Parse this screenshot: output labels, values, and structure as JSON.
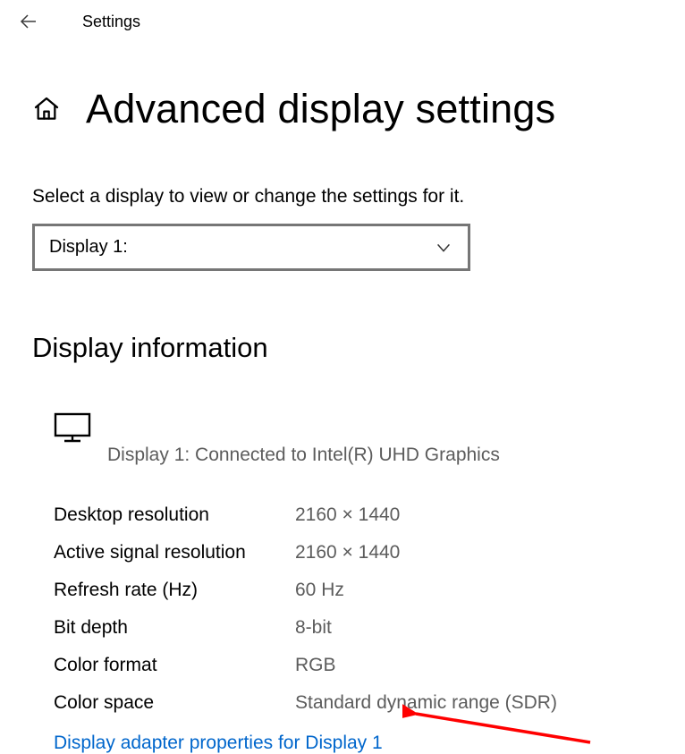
{
  "topbar": {
    "app_label": "Settings"
  },
  "header": {
    "title": "Advanced display settings"
  },
  "selector": {
    "instruction": "Select a display to view or change the settings for it.",
    "selected": "Display 1:"
  },
  "info_section": {
    "title": "Display information",
    "connected_text": "Display 1: Connected to Intel(R) UHD Graphics",
    "rows": [
      {
        "label": "Desktop resolution",
        "value": "2160 × 1440"
      },
      {
        "label": "Active signal resolution",
        "value": "2160 × 1440"
      },
      {
        "label": "Refresh rate (Hz)",
        "value": "60 Hz"
      },
      {
        "label": "Bit depth",
        "value": "8-bit"
      },
      {
        "label": "Color format",
        "value": "RGB"
      },
      {
        "label": "Color space",
        "value": "Standard dynamic range (SDR)"
      }
    ],
    "adapter_link": "Display adapter properties for Display 1"
  },
  "annotation": {
    "arrow_color": "#ff0000"
  }
}
